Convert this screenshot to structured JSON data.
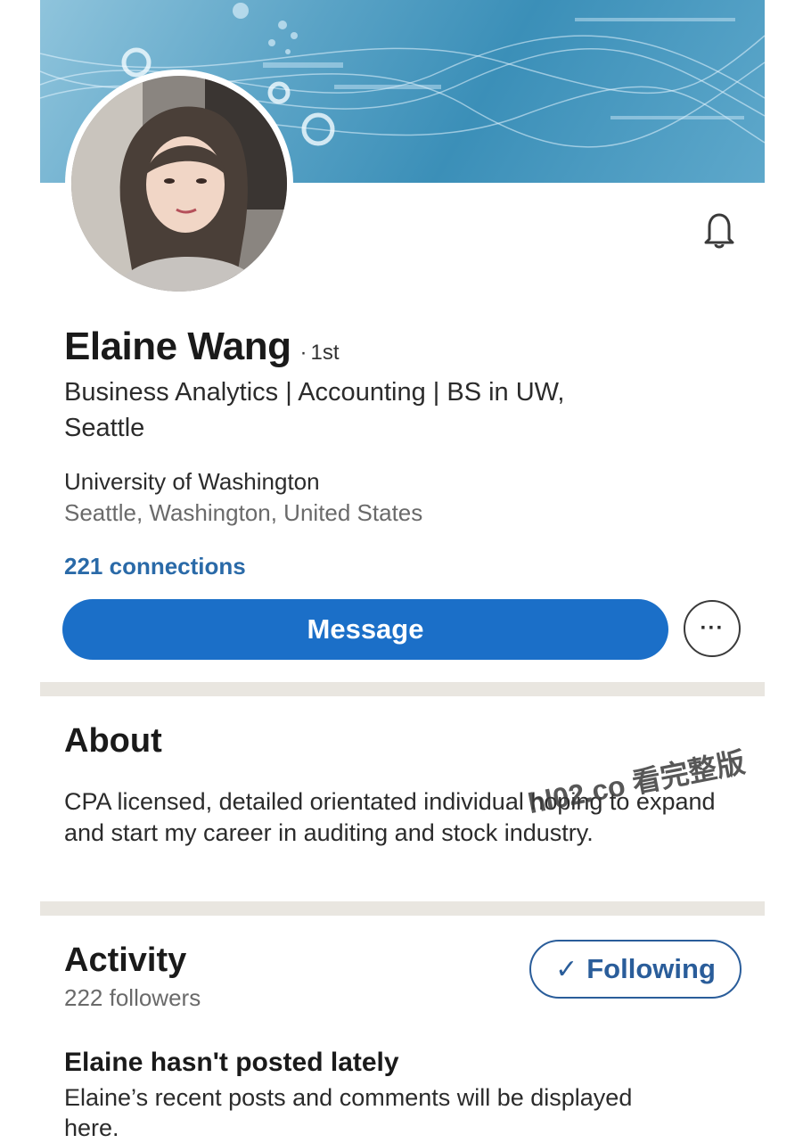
{
  "profile": {
    "name": "Elaine Wang",
    "separator": "·",
    "degree": "1st",
    "headline": "Business Analytics | Accounting | BS in UW, Seattle",
    "school": "University of Washington",
    "location": "Seattle, Washington, United States",
    "connections": "221 connections"
  },
  "actions": {
    "message_label": "Message",
    "more_label": "···"
  },
  "about": {
    "title": "About",
    "text": "CPA licensed, detailed orientated individual hoping to expand and start my career in auditing and stock industry."
  },
  "activity": {
    "title": "Activity",
    "followers": "222 followers",
    "following_check": "✓",
    "following_label": "Following",
    "empty_title": "Elaine hasn't posted lately",
    "empty_text": "Elaine’s recent posts and comments will be displayed here."
  },
  "watermark": "hl02.co 看完整版",
  "icons": {
    "notification": "bell-icon",
    "more": "more-dots-icon",
    "following": "check-icon"
  },
  "colors": {
    "primary_blue": "#1b6fc8",
    "link_blue": "#2a6aa8",
    "following_blue": "#2a5d9a",
    "banner_blue": "#3b8fb8",
    "divider": "#e9e6e0"
  }
}
